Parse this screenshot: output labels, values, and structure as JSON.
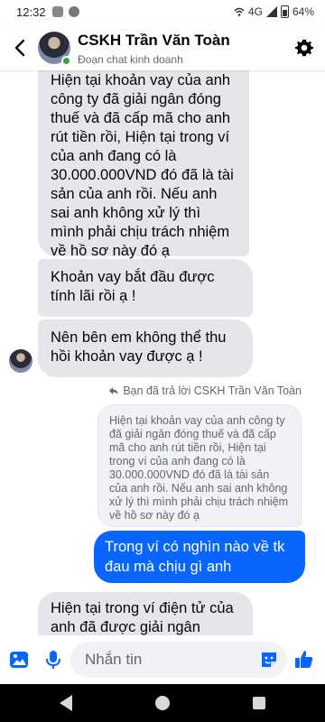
{
  "status_bar": {
    "time": "12:32",
    "network": "4G",
    "battery": "64%"
  },
  "header": {
    "contact_name": "CSKH Trần Văn Toàn",
    "subtitle": "Đoạn chat kinh doanh"
  },
  "messages": {
    "m1": "Hiện tại khoản vay của anh công ty đã giải ngân đóng thuế và đã cấp mã cho anh rút tiền rồi, Hiện tại trong ví của anh đang có là 30.000.000VND đó đã là tài sản của anh rồi. Nếu anh sai anh không xử lý thì mình phải chịu trách nhiệm về hồ sơ này đó ạ",
    "m2": "Khoản vay bắt đầu được tính lãi rồi ạ !",
    "m3": "Nên bên em không thể thu hồi khoản vay được ạ !",
    "reply_label": "Bạn đã trả lời CSKH Trần Văn Toàn",
    "quoted": "Hiện tại khoản vay của anh công ty đã giải ngân đóng thuế và đã cấp mã cho anh rút tiền rồi, Hiện tại trong ví của anh đang có là 30.000.000VND đó đã là tài sản của anh rồi. Nếu anh sai anh không xử lý thì mình phải chịu trách nhiệm về hồ sơ này đó ạ",
    "sent": "Trong ví có nghìn nào về tk đau mà chịu gì anh",
    "m4": "Hiện tại trong ví điện tử của anh đã được giải ngân"
  },
  "composer": {
    "placeholder": "Nhắn tin"
  },
  "colors": {
    "accent": "#0866ff",
    "incoming_bubble": "#e4e6eb",
    "online": "#31a24c"
  },
  "icons": [
    "back-arrow-icon",
    "gear-icon",
    "image-icon",
    "microphone-icon",
    "sticker-icon",
    "thumbs-up-icon",
    "reply-icon"
  ]
}
